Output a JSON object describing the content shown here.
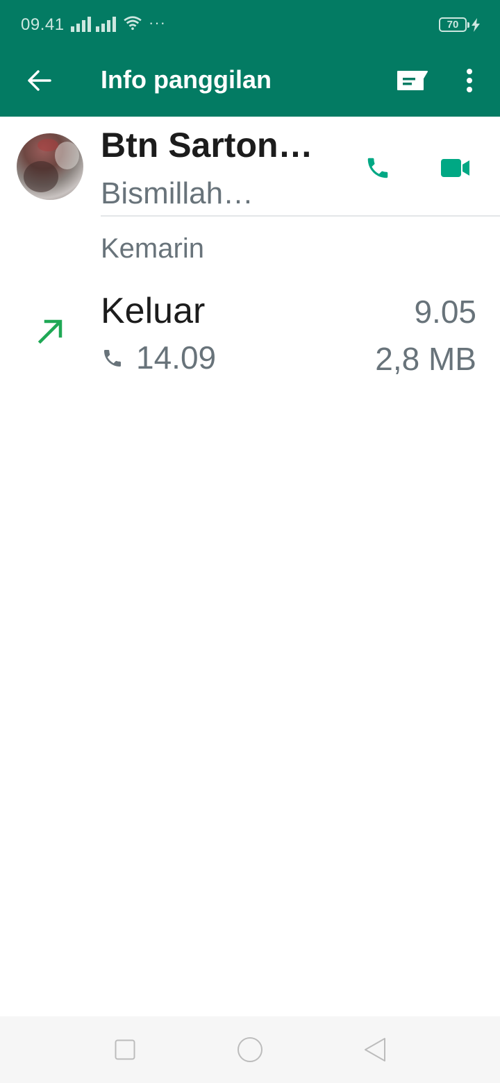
{
  "status_bar": {
    "time": "09.41",
    "battery": "70",
    "overflow": "···",
    "icons": [
      "signal-icon",
      "signal-icon",
      "wifi-icon",
      "battery-icon",
      "charging-icon"
    ]
  },
  "app_bar": {
    "title": "Info panggilan",
    "background": "#037b63",
    "icons": [
      "back-arrow-icon",
      "message-icon",
      "more-vert-icon"
    ]
  },
  "contact": {
    "name": "Btn Sarton…",
    "status": "Bismillah…",
    "actions": [
      "phone-icon",
      "video-camera-icon"
    ],
    "accent": "#00a884"
  },
  "calls": {
    "section_label": "Kemarin",
    "entries": [
      {
        "direction": "Keluar",
        "time": "9.05",
        "duration": "14.09",
        "size": "2,8 MB",
        "direction_icon": "outgoing-arrow-icon",
        "type_icon": "phone-icon"
      }
    ]
  },
  "nav_bar": {
    "icons": [
      "recent-apps-icon",
      "home-icon",
      "back-triangle-icon"
    ]
  }
}
